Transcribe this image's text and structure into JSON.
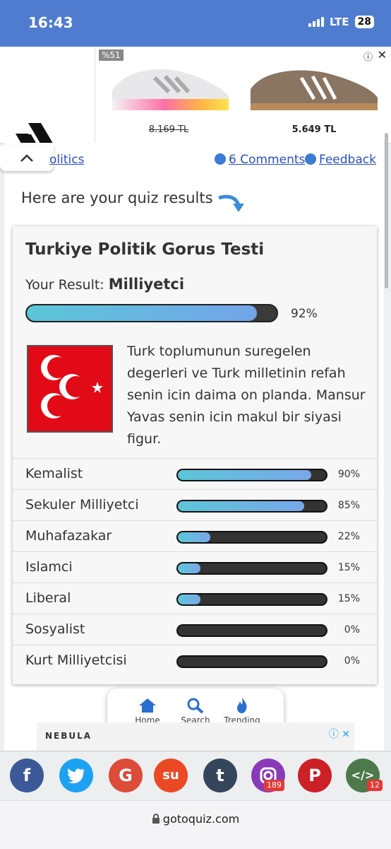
{
  "status": {
    "time": "16:43",
    "network": "LTE",
    "battery": "28"
  },
  "ad": {
    "discount_badge": "%51",
    "product1_price": "8.169 TL",
    "product2_price": "5.649 TL"
  },
  "nav": {
    "breadcrumb": "olitics",
    "comments": "6 Comments",
    "feedback": "Feedback"
  },
  "intro": "Here are your quiz results",
  "quiz": {
    "title": "Turkiye Politik Gorus Testi",
    "result_label": "Your Result:",
    "result_value": "Milliyetci",
    "result_percent": "92%",
    "result_fraction": 0.92,
    "description": "Turk toplumunun suregelen degerleri ve Turk milletinin refah senin icin daima on planda. Mansur Yavas senin icin makul bir siyasi figur.",
    "scores": [
      {
        "label": "Kemalist",
        "pct": "90%",
        "value": 0.9
      },
      {
        "label": "Sekuler Milliyetci",
        "pct": "85%",
        "value": 0.85
      },
      {
        "label": "Muhafazakar",
        "pct": "22%",
        "value": 0.22
      },
      {
        "label": "Islamci",
        "pct": "15%",
        "value": 0.15
      },
      {
        "label": "Liberal",
        "pct": "15%",
        "value": 0.15
      },
      {
        "label": "Sosyalist",
        "pct": "0%",
        "value": 0
      },
      {
        "label": "Kurt Milliyetcisi",
        "pct": "0%",
        "value": 0
      }
    ]
  },
  "bottom_nav": {
    "home": "Home",
    "search": "Search",
    "trending": "Trending"
  },
  "ad2": {
    "brand": "NEBULA"
  },
  "share": {
    "instagram_count": "189",
    "embed_count": "12"
  },
  "url": "gotoquiz.com"
}
